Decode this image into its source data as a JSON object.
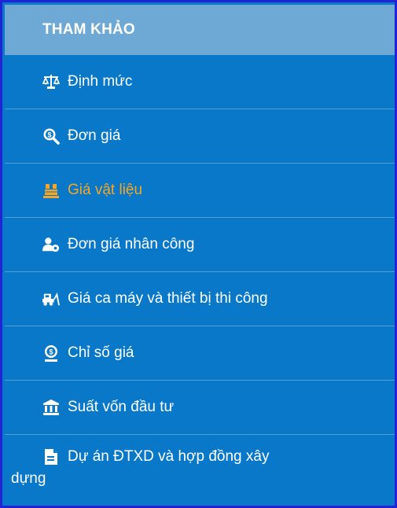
{
  "header": {
    "title": "THAM KHẢO"
  },
  "menu": {
    "items": [
      {
        "label": "Định mức",
        "icon": "scale-icon"
      },
      {
        "label": "Đơn giá",
        "icon": "search-money-icon"
      },
      {
        "label": "Giá vật liệu",
        "icon": "materials-icon",
        "active": true
      },
      {
        "label": "Đơn giá nhân công",
        "icon": "worker-icon"
      },
      {
        "label": "Giá ca máy và thiết bị thi công",
        "icon": "machine-icon"
      },
      {
        "label": "Chỉ số giá",
        "icon": "price-index-icon"
      },
      {
        "label": "Suất vốn đầu tư",
        "icon": "bank-icon"
      },
      {
        "label_line1": "Dự án ĐTXD và hợp đồng xây",
        "label_line2": "dựng",
        "icon": "document-icon"
      }
    ]
  },
  "colors": {
    "background": "#0a78c8",
    "header_background": "#6ea8d4",
    "active_text": "#f5a623",
    "text": "#ffffff",
    "frame_border": "#2222d6"
  }
}
